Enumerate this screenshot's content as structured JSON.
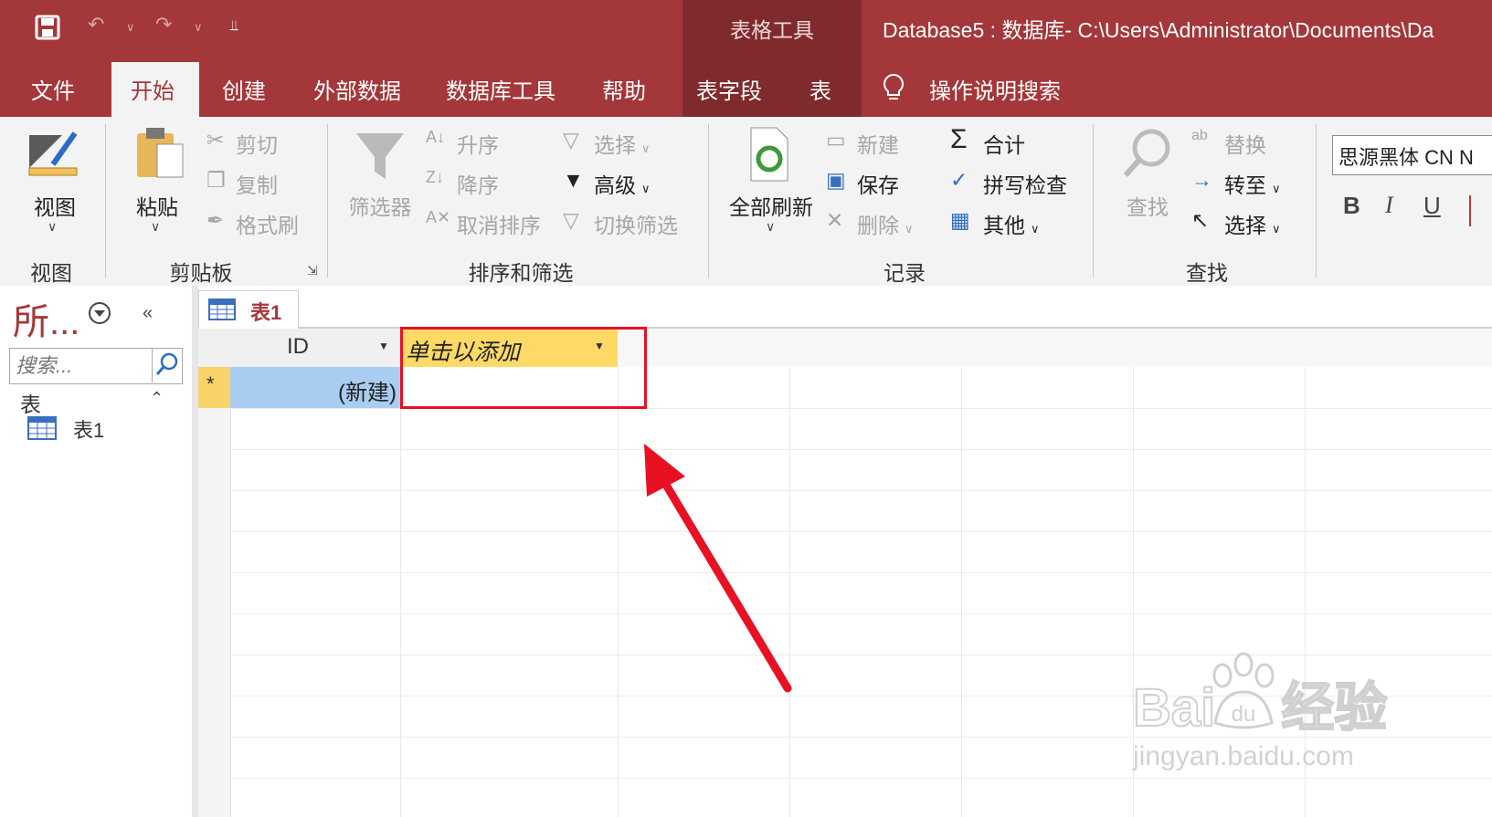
{
  "window": {
    "title": "Database5 : 数据库- C:\\Users\\Administrator\\Documents\\Da",
    "context_tab_group": "表格工具"
  },
  "tabs": [
    "文件",
    "开始",
    "创建",
    "外部数据",
    "数据库工具",
    "帮助",
    "表字段",
    "表"
  ],
  "tell_me": "操作说明搜索",
  "ribbon": {
    "view": {
      "button": "视图",
      "group": "视图"
    },
    "clipboard": {
      "paste": "粘贴",
      "cut": "剪切",
      "copy": "复制",
      "format_painter": "格式刷",
      "group": "剪贴板"
    },
    "sort_filter": {
      "filter": "筛选器",
      "ascending": "升序",
      "descending": "降序",
      "remove_sort": "取消排序",
      "selection": "选择",
      "advanced": "高级",
      "toggle_filter": "切换筛选",
      "group": "排序和筛选"
    },
    "records": {
      "refresh_all": "全部刷新",
      "new": "新建",
      "save": "保存",
      "delete": "删除",
      "totals": "合计",
      "spelling": "拼写检查",
      "more": "其他",
      "group": "记录"
    },
    "find": {
      "find": "查找",
      "replace": "替换",
      "goto": "转至",
      "select": "选择",
      "group": "查找"
    },
    "text_format": {
      "font": "思源黑体 CN N",
      "bold": "B",
      "italic": "I",
      "underline": "U"
    }
  },
  "nav_pane": {
    "title": "所...",
    "search_placeholder": "搜索...",
    "section": "表",
    "items": [
      "表1"
    ]
  },
  "document": {
    "tab": "表1",
    "columns": [
      "ID",
      "单击以添加"
    ],
    "new_row": {
      "marker": "*",
      "id": "(新建)"
    }
  },
  "watermark": {
    "logo": "Bai du 经验",
    "url": "jingyan.baidu.com"
  },
  "colors": {
    "accent": "#a4373a",
    "highlight": "#e81123",
    "selected_header": "#ffd966",
    "new_row": "#a9cdf0"
  }
}
